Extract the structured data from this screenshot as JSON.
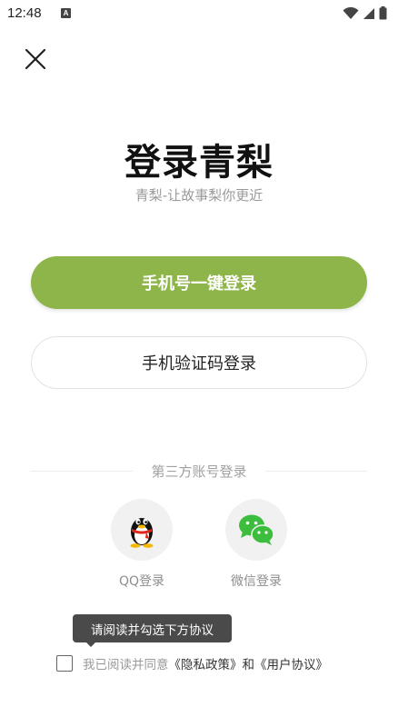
{
  "status_bar": {
    "time": "12:48",
    "notification_icon_letter": "A",
    "icons": [
      "a-notification-icon",
      "wifi-icon",
      "signal-icon",
      "battery-icon"
    ]
  },
  "header": {
    "close_icon": "close-icon"
  },
  "hero": {
    "title": "登录青梨",
    "subtitle": "青梨-让故事梨你更近"
  },
  "login": {
    "one_click_label": "手机号一键登录",
    "sms_code_label": "手机验证码登录"
  },
  "third_party": {
    "divider_label": "第三方账号登录",
    "providers": [
      {
        "label": "QQ登录",
        "icon": "qq-penguin-icon"
      },
      {
        "label": "微信登录",
        "icon": "wechat-icon"
      }
    ]
  },
  "agreement": {
    "tooltip": "请阅读并勾选下方协议",
    "prefix": "我已阅读并同意",
    "privacy_link": "《隐私政策》",
    "and": "和",
    "user_link": "《用户协议》",
    "checked": false
  },
  "colors": {
    "primary_green": "#8db54a",
    "wechat_green": "#3dbd3d",
    "tooltip_bg": "#4a4a4a"
  }
}
